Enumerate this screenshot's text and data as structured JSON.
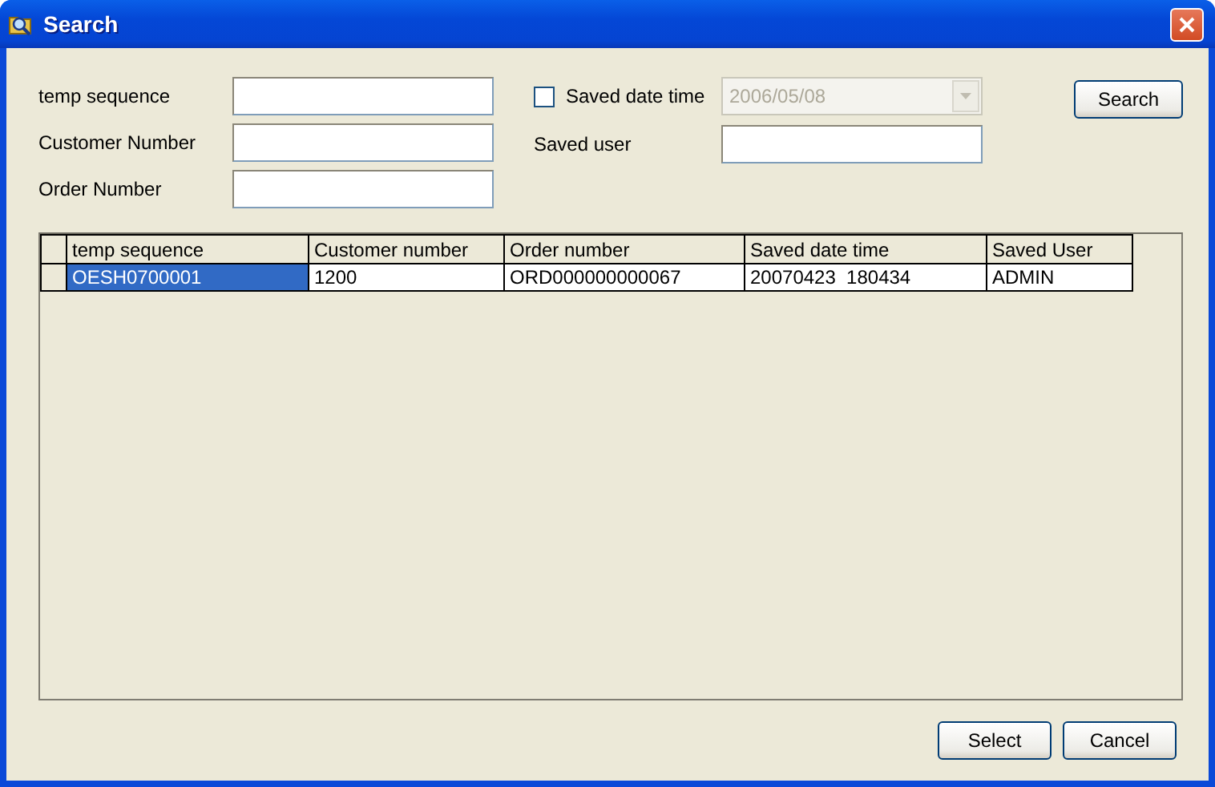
{
  "window": {
    "title": "Search"
  },
  "form": {
    "left_fields": [
      {
        "label": "temp sequence"
      },
      {
        "label": "Customer Number"
      },
      {
        "label": "Order Number"
      }
    ],
    "saved_date_time": {
      "label": "Saved date time",
      "checked": false,
      "value": "2006/05/08",
      "disabled": true
    },
    "saved_user": {
      "label": "Saved user"
    },
    "search_button": "Search"
  },
  "table": {
    "columns": [
      "temp sequence",
      "Customer number",
      "Order number",
      "Saved date time",
      "Saved User"
    ],
    "rows": [
      {
        "selected": true,
        "cells": [
          "OESH0700001",
          "1200",
          "ORD000000000067",
          "20070423  180434",
          "ADMIN"
        ]
      }
    ]
  },
  "buttons": [
    "Select",
    "Cancel"
  ]
}
